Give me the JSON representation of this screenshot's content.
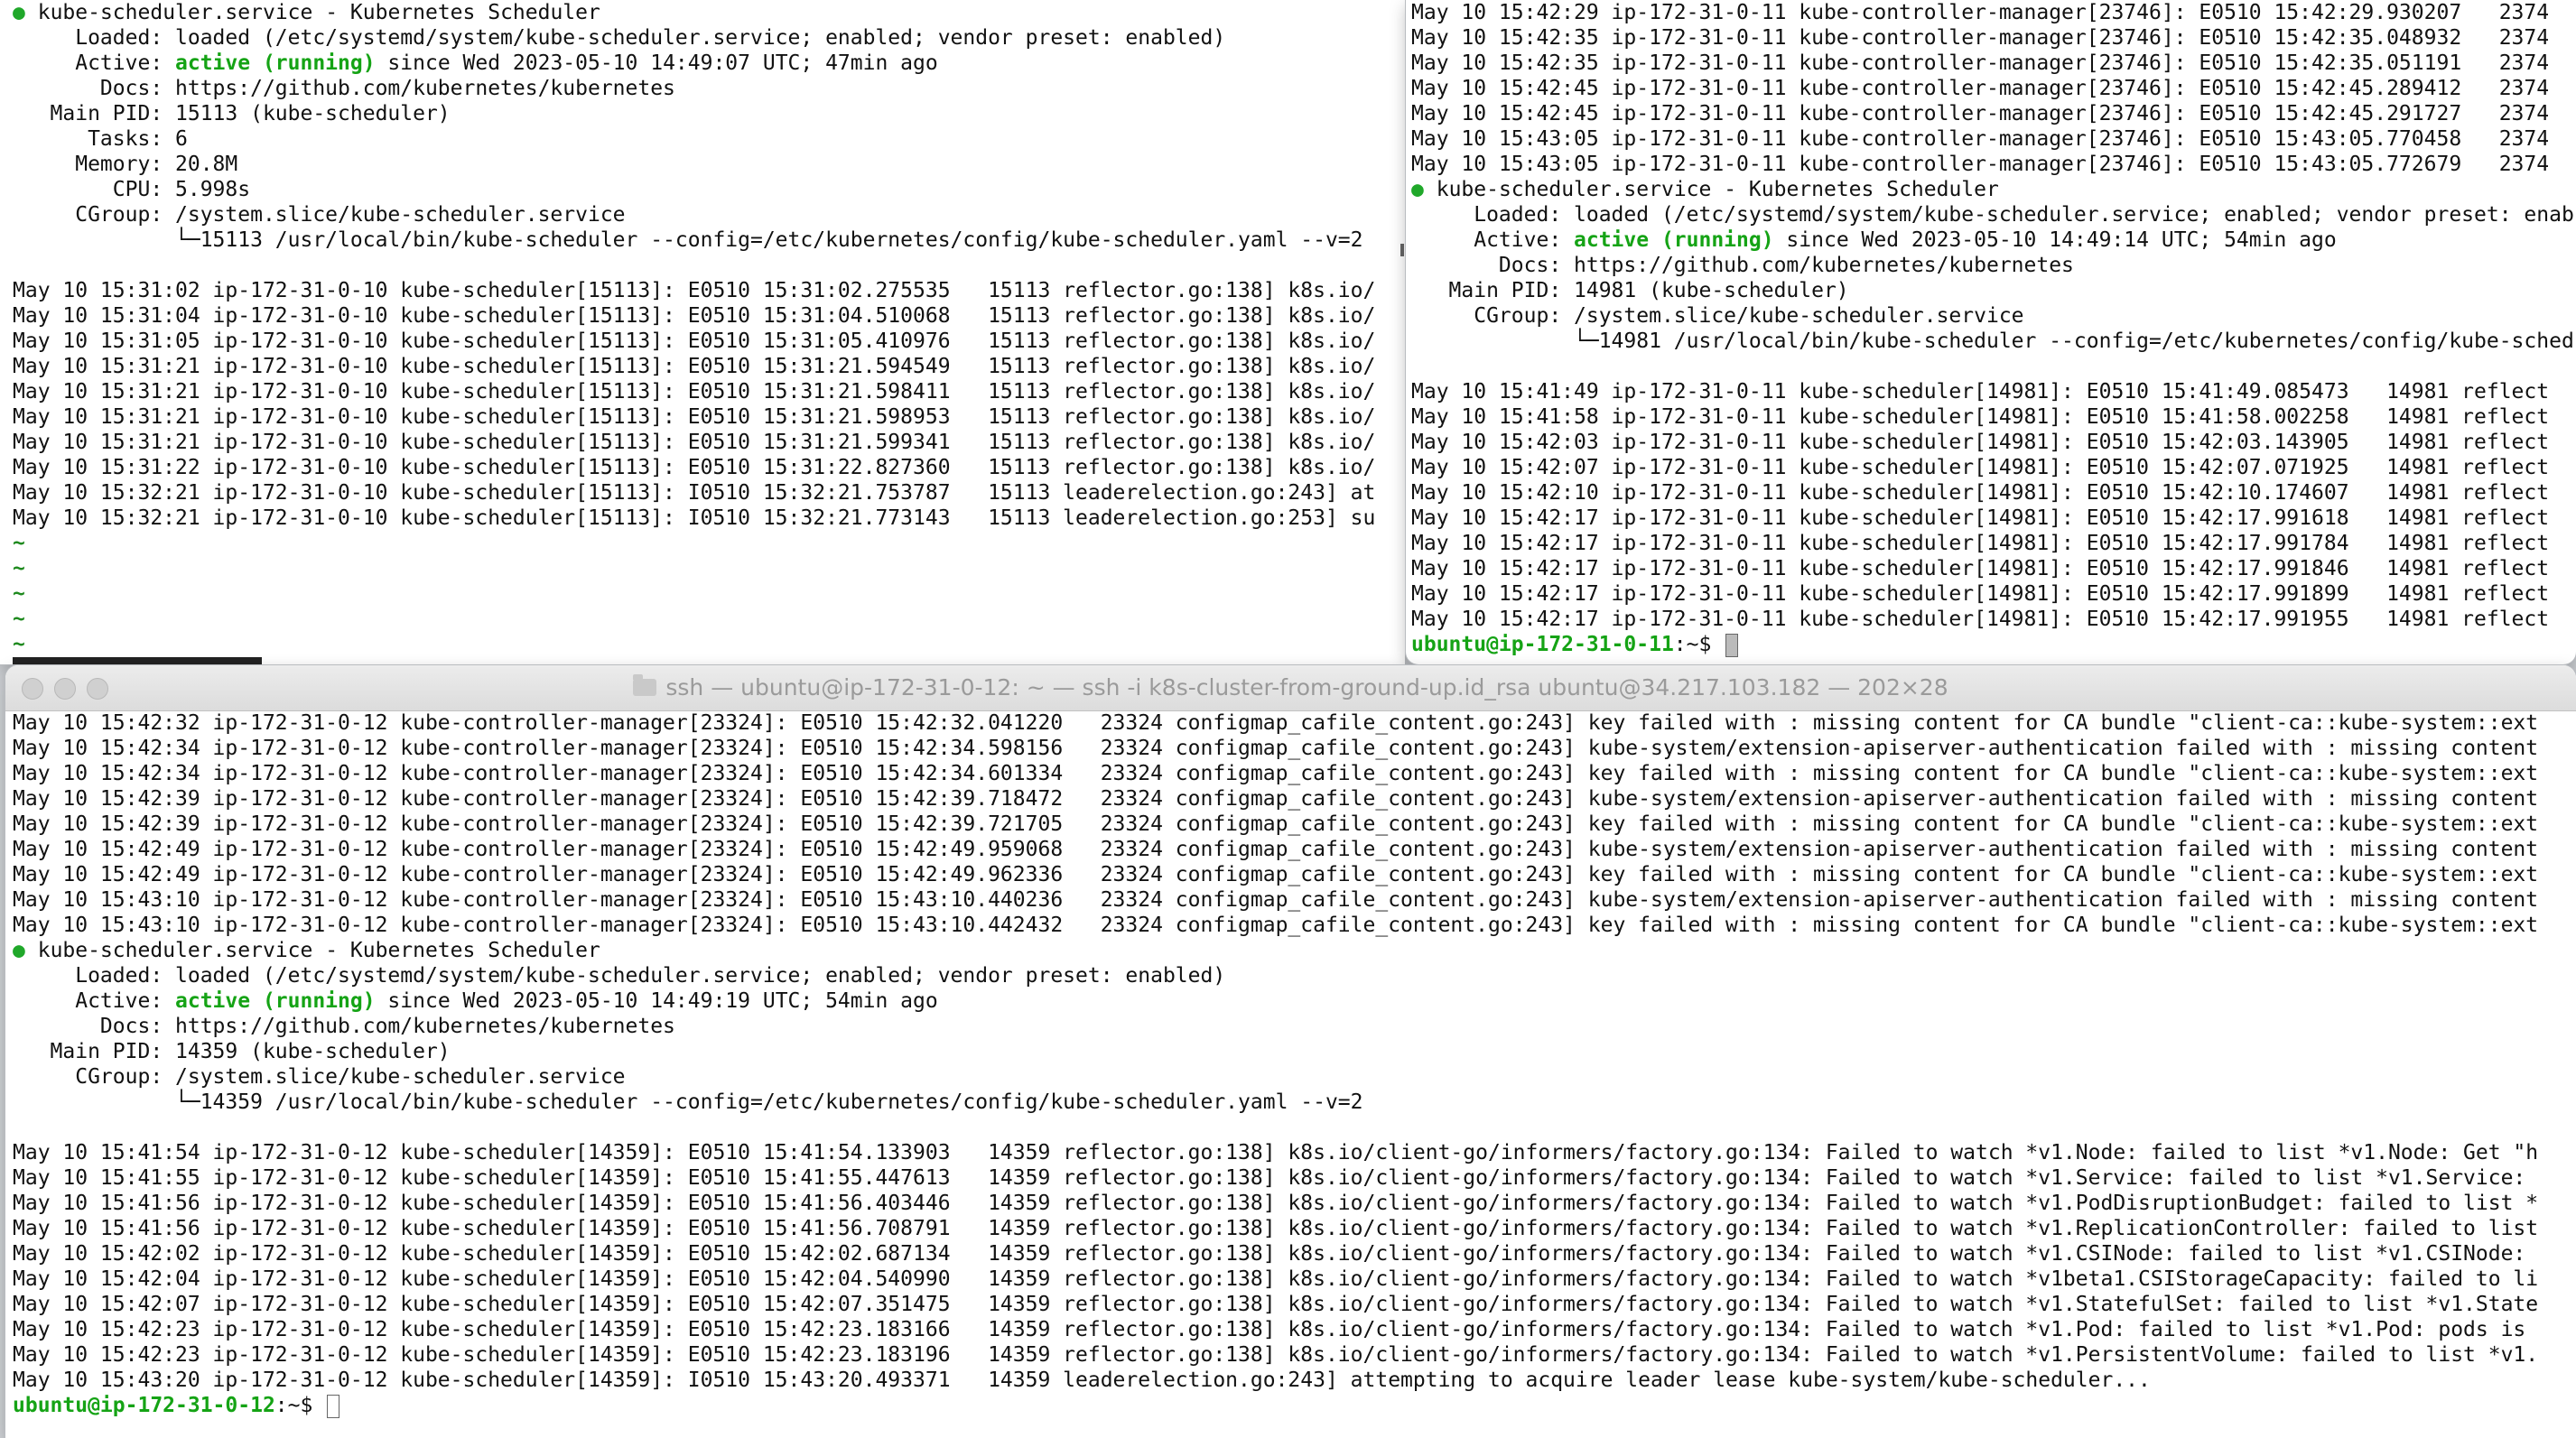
{
  "top_left": {
    "status": {
      "header": "kube-scheduler.service - Kubernetes Scheduler",
      "loaded": "     Loaded: loaded (/etc/systemd/system/kube-scheduler.service; enabled; vendor preset: enabled)",
      "active_label": "     Active: ",
      "active_state": "active (running)",
      "active_rest": " since Wed 2023-05-10 14:49:07 UTC; 47min ago",
      "docs": "       Docs: https://github.com/kubernetes/kubernetes",
      "main_pid": "   Main PID: 15113 (kube-scheduler)",
      "tasks": "      Tasks: 6",
      "memory": "     Memory: 20.8M",
      "cpu": "        CPU: 5.998s",
      "cgroup": "     CGroup: /system.slice/kube-scheduler.service",
      "cgroup_child": "             └─15113 /usr/local/bin/kube-scheduler --config=/etc/kubernetes/config/kube-scheduler.yaml --v=2"
    },
    "logs": [
      "May 10 15:31:02 ip-172-31-0-10 kube-scheduler[15113]: E0510 15:31:02.275535   15113 reflector.go:138] k8s.io/",
      "May 10 15:31:04 ip-172-31-0-10 kube-scheduler[15113]: E0510 15:31:04.510068   15113 reflector.go:138] k8s.io/",
      "May 10 15:31:05 ip-172-31-0-10 kube-scheduler[15113]: E0510 15:31:05.410976   15113 reflector.go:138] k8s.io/",
      "May 10 15:31:21 ip-172-31-0-10 kube-scheduler[15113]: E0510 15:31:21.594549   15113 reflector.go:138] k8s.io/",
      "May 10 15:31:21 ip-172-31-0-10 kube-scheduler[15113]: E0510 15:31:21.598411   15113 reflector.go:138] k8s.io/",
      "May 10 15:31:21 ip-172-31-0-10 kube-scheduler[15113]: E0510 15:31:21.598953   15113 reflector.go:138] k8s.io/",
      "May 10 15:31:21 ip-172-31-0-10 kube-scheduler[15113]: E0510 15:31:21.599341   15113 reflector.go:138] k8s.io/",
      "May 10 15:31:22 ip-172-31-0-10 kube-scheduler[15113]: E0510 15:31:22.827360   15113 reflector.go:138] k8s.io/",
      "May 10 15:32:21 ip-172-31-0-10 kube-scheduler[15113]: I0510 15:32:21.753787   15113 leaderelection.go:243] at",
      "May 10 15:32:21 ip-172-31-0-10 kube-scheduler[15113]: I0510 15:32:21.773143   15113 leaderelection.go:253] su"
    ],
    "tilde": "~"
  },
  "top_right": {
    "controller_logs": [
      "May 10 15:42:29 ip-172-31-0-11 kube-controller-manager[23746]: E0510 15:42:29.930207   2374",
      "May 10 15:42:35 ip-172-31-0-11 kube-controller-manager[23746]: E0510 15:42:35.048932   2374",
      "May 10 15:42:35 ip-172-31-0-11 kube-controller-manager[23746]: E0510 15:42:35.051191   2374",
      "May 10 15:42:45 ip-172-31-0-11 kube-controller-manager[23746]: E0510 15:42:45.289412   2374",
      "May 10 15:42:45 ip-172-31-0-11 kube-controller-manager[23746]: E0510 15:42:45.291727   2374",
      "May 10 15:43:05 ip-172-31-0-11 kube-controller-manager[23746]: E0510 15:43:05.770458   2374",
      "May 10 15:43:05 ip-172-31-0-11 kube-controller-manager[23746]: E0510 15:43:05.772679   2374"
    ],
    "status": {
      "header": "kube-scheduler.service - Kubernetes Scheduler",
      "loaded": "     Loaded: loaded (/etc/systemd/system/kube-scheduler.service; enabled; vendor preset: enab",
      "active_label": "     Active: ",
      "active_state": "active (running)",
      "active_rest": " since Wed 2023-05-10 14:49:14 UTC; 54min ago",
      "docs": "       Docs: https://github.com/kubernetes/kubernetes",
      "main_pid": "   Main PID: 14981 (kube-scheduler)",
      "cgroup": "     CGroup: /system.slice/kube-scheduler.service",
      "cgroup_child": "             └─14981 /usr/local/bin/kube-scheduler --config=/etc/kubernetes/config/kube-sched"
    },
    "scheduler_logs": [
      "May 10 15:41:49 ip-172-31-0-11 kube-scheduler[14981]: E0510 15:41:49.085473   14981 reflect",
      "May 10 15:41:58 ip-172-31-0-11 kube-scheduler[14981]: E0510 15:41:58.002258   14981 reflect",
      "May 10 15:42:03 ip-172-31-0-11 kube-scheduler[14981]: E0510 15:42:03.143905   14981 reflect",
      "May 10 15:42:07 ip-172-31-0-11 kube-scheduler[14981]: E0510 15:42:07.071925   14981 reflect",
      "May 10 15:42:10 ip-172-31-0-11 kube-scheduler[14981]: E0510 15:42:10.174607   14981 reflect",
      "May 10 15:42:17 ip-172-31-0-11 kube-scheduler[14981]: E0510 15:42:17.991618   14981 reflect",
      "May 10 15:42:17 ip-172-31-0-11 kube-scheduler[14981]: E0510 15:42:17.991784   14981 reflect",
      "May 10 15:42:17 ip-172-31-0-11 kube-scheduler[14981]: E0510 15:42:17.991846   14981 reflect",
      "May 10 15:42:17 ip-172-31-0-11 kube-scheduler[14981]: E0510 15:42:17.991899   14981 reflect",
      "May 10 15:42:17 ip-172-31-0-11 kube-scheduler[14981]: E0510 15:42:17.991955   14981 reflect"
    ],
    "prompt_user": "ubuntu@ip-172-31-0-11",
    "prompt_suffix": ":~$ "
  },
  "bottom": {
    "title": "ssh — ubuntu@ip-172-31-0-12: ~ — ssh -i k8s-cluster-from-ground-up.id_rsa ubuntu@34.217.103.182 — 202×28",
    "controller_logs": [
      "May 10 15:42:32 ip-172-31-0-12 kube-controller-manager[23324]: E0510 15:42:32.041220   23324 configmap_cafile_content.go:243] key failed with : missing content for CA bundle \"client-ca::kube-system::ext",
      "May 10 15:42:34 ip-172-31-0-12 kube-controller-manager[23324]: E0510 15:42:34.598156   23324 configmap_cafile_content.go:243] kube-system/extension-apiserver-authentication failed with : missing content",
      "May 10 15:42:34 ip-172-31-0-12 kube-controller-manager[23324]: E0510 15:42:34.601334   23324 configmap_cafile_content.go:243] key failed with : missing content for CA bundle \"client-ca::kube-system::ext",
      "May 10 15:42:39 ip-172-31-0-12 kube-controller-manager[23324]: E0510 15:42:39.718472   23324 configmap_cafile_content.go:243] kube-system/extension-apiserver-authentication failed with : missing content",
      "May 10 15:42:39 ip-172-31-0-12 kube-controller-manager[23324]: E0510 15:42:39.721705   23324 configmap_cafile_content.go:243] key failed with : missing content for CA bundle \"client-ca::kube-system::ext",
      "May 10 15:42:49 ip-172-31-0-12 kube-controller-manager[23324]: E0510 15:42:49.959068   23324 configmap_cafile_content.go:243] kube-system/extension-apiserver-authentication failed with : missing content",
      "May 10 15:42:49 ip-172-31-0-12 kube-controller-manager[23324]: E0510 15:42:49.962336   23324 configmap_cafile_content.go:243] key failed with : missing content for CA bundle \"client-ca::kube-system::ext",
      "May 10 15:43:10 ip-172-31-0-12 kube-controller-manager[23324]: E0510 15:43:10.440236   23324 configmap_cafile_content.go:243] kube-system/extension-apiserver-authentication failed with : missing content",
      "May 10 15:43:10 ip-172-31-0-12 kube-controller-manager[23324]: E0510 15:43:10.442432   23324 configmap_cafile_content.go:243] key failed with : missing content for CA bundle \"client-ca::kube-system::ext"
    ],
    "status": {
      "header": "kube-scheduler.service - Kubernetes Scheduler",
      "loaded": "     Loaded: loaded (/etc/systemd/system/kube-scheduler.service; enabled; vendor preset: enabled)",
      "active_label": "     Active: ",
      "active_state": "active (running)",
      "active_rest": " since Wed 2023-05-10 14:49:19 UTC; 54min ago",
      "docs": "       Docs: https://github.com/kubernetes/kubernetes",
      "main_pid": "   Main PID: 14359 (kube-scheduler)",
      "cgroup": "     CGroup: /system.slice/kube-scheduler.service",
      "cgroup_child": "             └─14359 /usr/local/bin/kube-scheduler --config=/etc/kubernetes/config/kube-scheduler.yaml --v=2"
    },
    "scheduler_logs": [
      "May 10 15:41:54 ip-172-31-0-12 kube-scheduler[14359]: E0510 15:41:54.133903   14359 reflector.go:138] k8s.io/client-go/informers/factory.go:134: Failed to watch *v1.Node: failed to list *v1.Node: Get \"h",
      "May 10 15:41:55 ip-172-31-0-12 kube-scheduler[14359]: E0510 15:41:55.447613   14359 reflector.go:138] k8s.io/client-go/informers/factory.go:134: Failed to watch *v1.Service: failed to list *v1.Service:",
      "May 10 15:41:56 ip-172-31-0-12 kube-scheduler[14359]: E0510 15:41:56.403446   14359 reflector.go:138] k8s.io/client-go/informers/factory.go:134: Failed to watch *v1.PodDisruptionBudget: failed to list *",
      "May 10 15:41:56 ip-172-31-0-12 kube-scheduler[14359]: E0510 15:41:56.708791   14359 reflector.go:138] k8s.io/client-go/informers/factory.go:134: Failed to watch *v1.ReplicationController: failed to list",
      "May 10 15:42:02 ip-172-31-0-12 kube-scheduler[14359]: E0510 15:42:02.687134   14359 reflector.go:138] k8s.io/client-go/informers/factory.go:134: Failed to watch *v1.CSINode: failed to list *v1.CSINode:",
      "May 10 15:42:04 ip-172-31-0-12 kube-scheduler[14359]: E0510 15:42:04.540990   14359 reflector.go:138] k8s.io/client-go/informers/factory.go:134: Failed to watch *v1beta1.CSIStorageCapacity: failed to li",
      "May 10 15:42:07 ip-172-31-0-12 kube-scheduler[14359]: E0510 15:42:07.351475   14359 reflector.go:138] k8s.io/client-go/informers/factory.go:134: Failed to watch *v1.StatefulSet: failed to list *v1.State",
      "May 10 15:42:23 ip-172-31-0-12 kube-scheduler[14359]: E0510 15:42:23.183166   14359 reflector.go:138] k8s.io/client-go/informers/factory.go:134: Failed to watch *v1.Pod: failed to list *v1.Pod: pods is",
      "May 10 15:42:23 ip-172-31-0-12 kube-scheduler[14359]: E0510 15:42:23.183196   14359 reflector.go:138] k8s.io/client-go/informers/factory.go:134: Failed to watch *v1.PersistentVolume: failed to list *v1.",
      "May 10 15:43:20 ip-172-31-0-12 kube-scheduler[14359]: I0510 15:43:20.493371   14359 leaderelection.go:243] attempting to acquire leader lease kube-system/kube-scheduler..."
    ],
    "prompt_user": "ubuntu@ip-172-31-0-12",
    "prompt_suffix": ":~$ "
  },
  "colors": {
    "active_green": "#15a315",
    "dot_green": "#20a82a",
    "title_gray": "#9a9a9a"
  }
}
